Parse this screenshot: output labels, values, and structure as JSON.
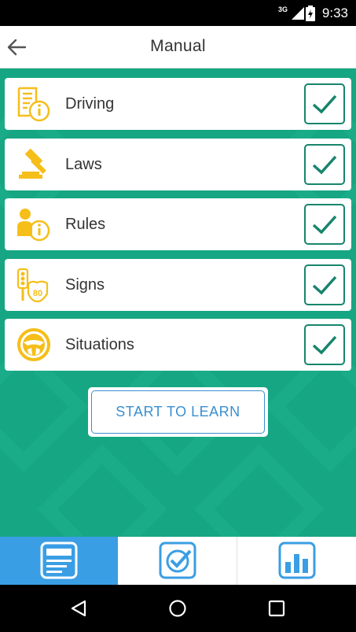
{
  "status_bar": {
    "network": "3G",
    "time": "9:33"
  },
  "toolbar": {
    "title": "Manual"
  },
  "categories": [
    {
      "label": "Driving",
      "icon": "document-info-icon",
      "checked": true
    },
    {
      "label": "Laws",
      "icon": "gavel-icon",
      "checked": true
    },
    {
      "label": "Rules",
      "icon": "person-info-icon",
      "checked": true
    },
    {
      "label": "Signs",
      "icon": "road-sign-icon",
      "sign_number": "80",
      "checked": true
    },
    {
      "label": "Situations",
      "icon": "steering-wheel-icon",
      "checked": true
    }
  ],
  "start_button": {
    "label": "START TO LEARN"
  },
  "tabs": [
    {
      "name": "manual",
      "icon": "manual-card-icon",
      "active": true
    },
    {
      "name": "test",
      "icon": "checkbox-icon",
      "active": false
    },
    {
      "name": "stats",
      "icon": "bar-chart-icon",
      "active": false
    }
  ],
  "colors": {
    "content_bg": "#16a683",
    "accent_blue": "#3a9ee4",
    "icon_yellow": "#f6be19",
    "check_green": "#17856c"
  }
}
